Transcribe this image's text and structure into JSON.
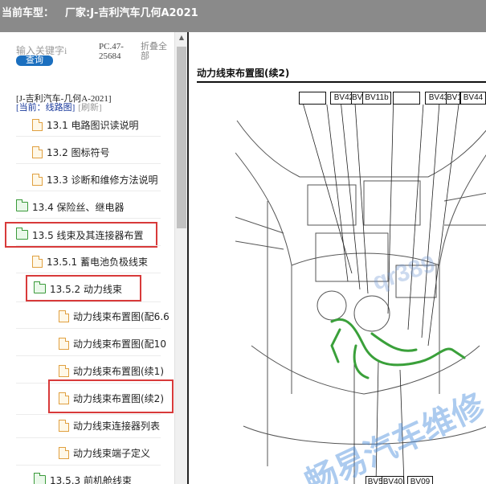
{
  "title_bar": {
    "model_label": "当前车型：",
    "model_value": "厂家:J-吉利汽车几何A2021"
  },
  "sidebar": {
    "search_placeholder": "输入关键字i",
    "search_button": "查询",
    "pc_code": "PC.47-\n25684",
    "collapse_all": "折叠全\n部",
    "vehicle": "[J-吉利汽车-几何A-2021]",
    "current_label": "[当前：线路图]",
    "refresh_label": "[刷新]",
    "items": [
      {
        "label": "13.1 电路图识读说明",
        "icon": "file-icon"
      },
      {
        "label": "13.2 图标符号",
        "icon": "file-icon"
      },
      {
        "label": "13.3 诊断和维修方法说明",
        "icon": "file-icon"
      },
      {
        "label": "13.4 保险丝、继电器",
        "icon": "folder-icon"
      },
      {
        "label": "13.5 线束及其连接器布置",
        "icon": "folder-icon"
      },
      {
        "label": "13.5.1 蓄电池负极线束",
        "icon": "file-icon"
      },
      {
        "label": "13.5.2 动力线束",
        "icon": "folder-icon"
      },
      {
        "label": "动力线束布置图(配6.6",
        "icon": "file-icon"
      },
      {
        "label": "动力线束布置图(配10",
        "icon": "file-icon"
      },
      {
        "label": "动力线束布置图(续1)",
        "icon": "file-icon"
      },
      {
        "label": "动力线束布置图(续2)",
        "icon": "file-icon"
      },
      {
        "label": "动力线束连接器列表",
        "icon": "file-icon"
      },
      {
        "label": "动力线束端子定义",
        "icon": "file-icon"
      },
      {
        "label": "13.5.3 前机舱线束",
        "icon": "folder-icon"
      }
    ]
  },
  "document": {
    "title": "动力线束布置图(续2)",
    "connectors": [
      "",
      "BV42",
      "BV61",
      "BV11b",
      "",
      "BV43",
      "BV14",
      "BV44"
    ],
    "bottom_connectors": [
      "BV58",
      "BV40",
      "BV09"
    ],
    "watermark_small": "qr389",
    "watermark_large": "畅易汽车维修"
  }
}
